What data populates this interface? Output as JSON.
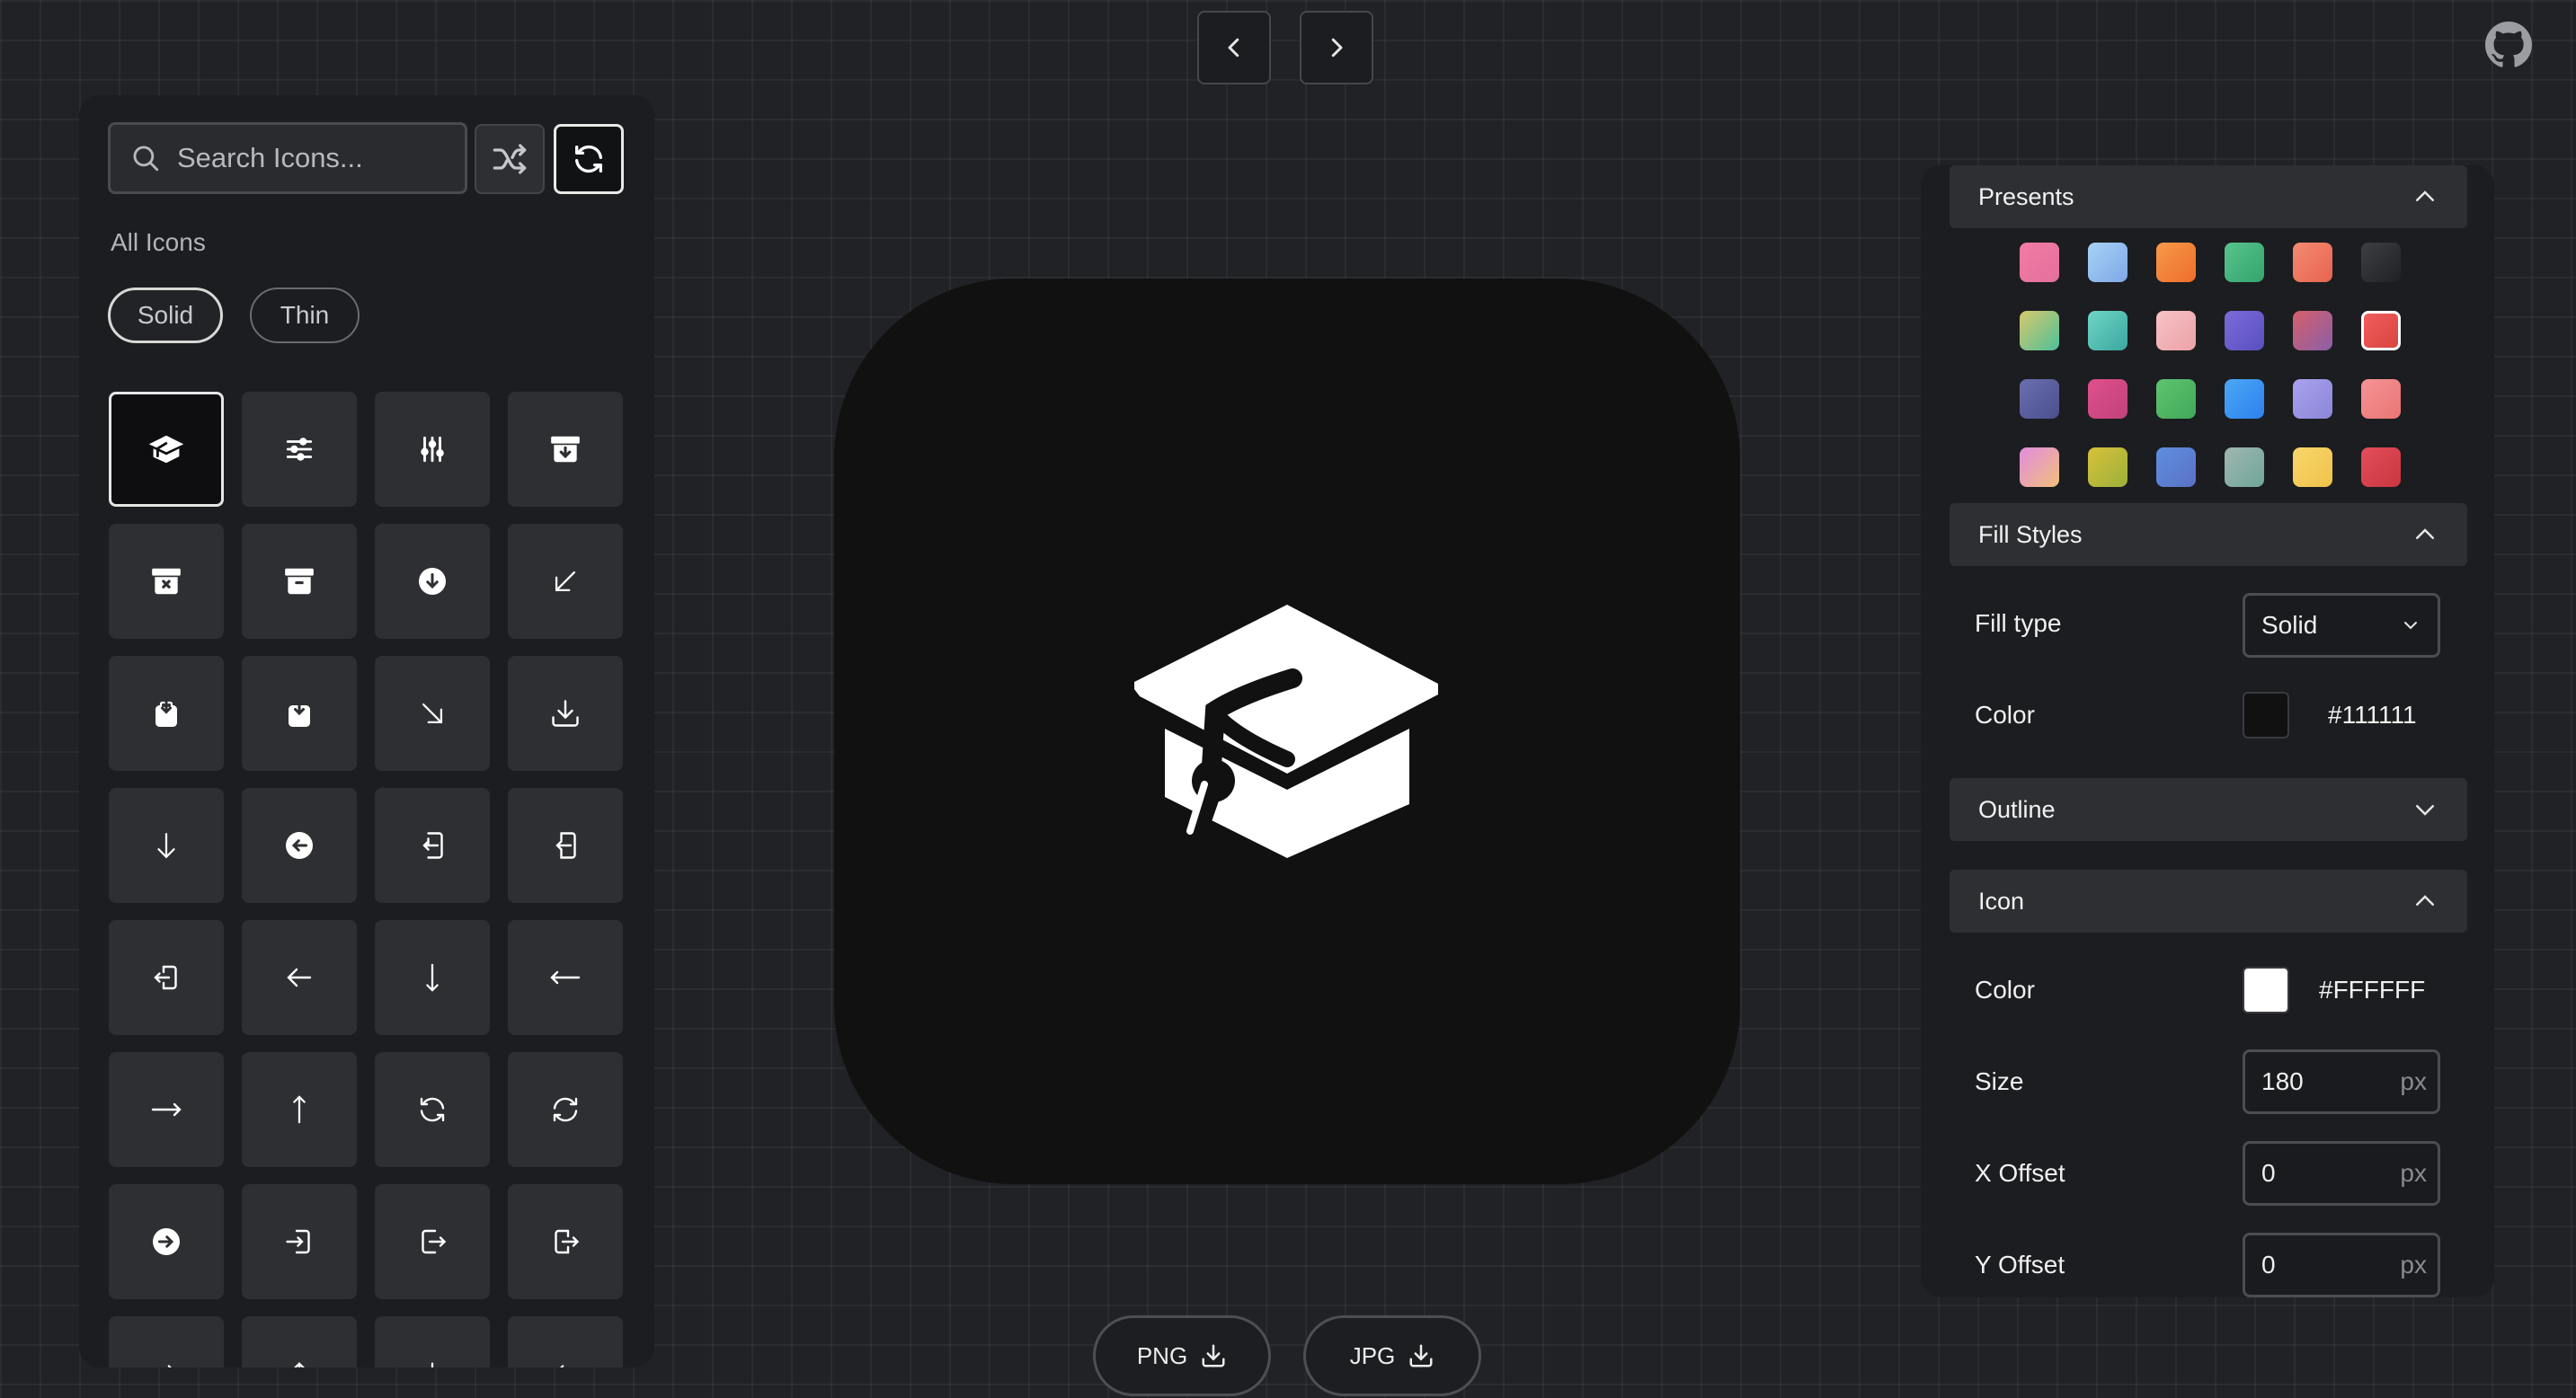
{
  "search": {
    "placeholder": "Search Icons..."
  },
  "library": {
    "section_title": "All Icons",
    "styles": [
      "Solid",
      "Thin"
    ],
    "selected_style": "Solid",
    "icons": [
      "graduation-cap",
      "sliders-horizontal",
      "sliders-vertical",
      "archive-down",
      "archive-x",
      "archive",
      "circle-arrow-down",
      "arrow-down-left",
      "clipboard-download",
      "clipboard-download-solid",
      "arrow-down-right",
      "download",
      "arrow-down",
      "circle-arrow-left",
      "login-left",
      "login-left-alt",
      "logout-left",
      "arrow-left",
      "arrow-down-thin",
      "arrow-left-thin",
      "arrow-right",
      "arrow-up",
      "refresh",
      "refresh-alt",
      "circle-arrow-right",
      "login-right",
      "logout-right",
      "logout-right-alt"
    ],
    "selected_icon": "graduation-cap"
  },
  "export": {
    "png_label": "PNG",
    "jpg_label": "JPG"
  },
  "settings": {
    "presets": {
      "title": "Presents",
      "swatches": [
        [
          "#f17ca4",
          "#e46f9c"
        ],
        [
          "#a6d3f5",
          "#7fa7e8"
        ],
        [
          "#f79a4a",
          "#ee6d2a"
        ],
        [
          "#57c48b",
          "#34a46d"
        ],
        [
          "#f58a72",
          "#e6644f"
        ],
        [
          "#3e3f43",
          "#202124"
        ],
        [
          "#d6c96b",
          "#4fbf9a"
        ],
        [
          "#6fd6c6",
          "#3ba7a0"
        ],
        [
          "#f7c3c6",
          "#eca0a7"
        ],
        [
          "#7b6bd9",
          "#5a4fc0"
        ],
        [
          "#d65f6a",
          "#8a5fa8"
        ],
        [
          "#f05d5d",
          "#d9443e"
        ],
        [
          "#6a6fb0",
          "#4b4f8e"
        ],
        [
          "#e0508c",
          "#c0427c"
        ],
        [
          "#5fc46f",
          "#40a85a"
        ],
        [
          "#4aa8f5",
          "#2f80ed"
        ],
        [
          "#a8a2ee",
          "#8c86d8"
        ],
        [
          "#f59495",
          "#ea7474"
        ],
        [
          "#e28be0",
          "#f0c07a"
        ],
        [
          "#d8c13a",
          "#9bb03a"
        ],
        [
          "#5f8ee0",
          "#5a71c6"
        ],
        [
          "#9fb6b0",
          "#6fa69a"
        ],
        [
          "#f7d66b",
          "#f1c24a"
        ],
        [
          "#e34e5a",
          "#c9363f"
        ]
      ],
      "selected_index": 11
    },
    "fill": {
      "title": "Fill Styles",
      "type_label": "Fill type",
      "type_value": "Solid",
      "color_label": "Color",
      "color_value": "#111111"
    },
    "outline": {
      "title": "Outline"
    },
    "icon": {
      "title": "Icon",
      "color_label": "Color",
      "color_value": "#FFFFFF",
      "size_label": "Size",
      "size_value": "180",
      "xoffset_label": "X Offset",
      "xoffset_value": "0",
      "yoffset_label": "Y Offset",
      "yoffset_value": "0",
      "unit": "px"
    }
  }
}
